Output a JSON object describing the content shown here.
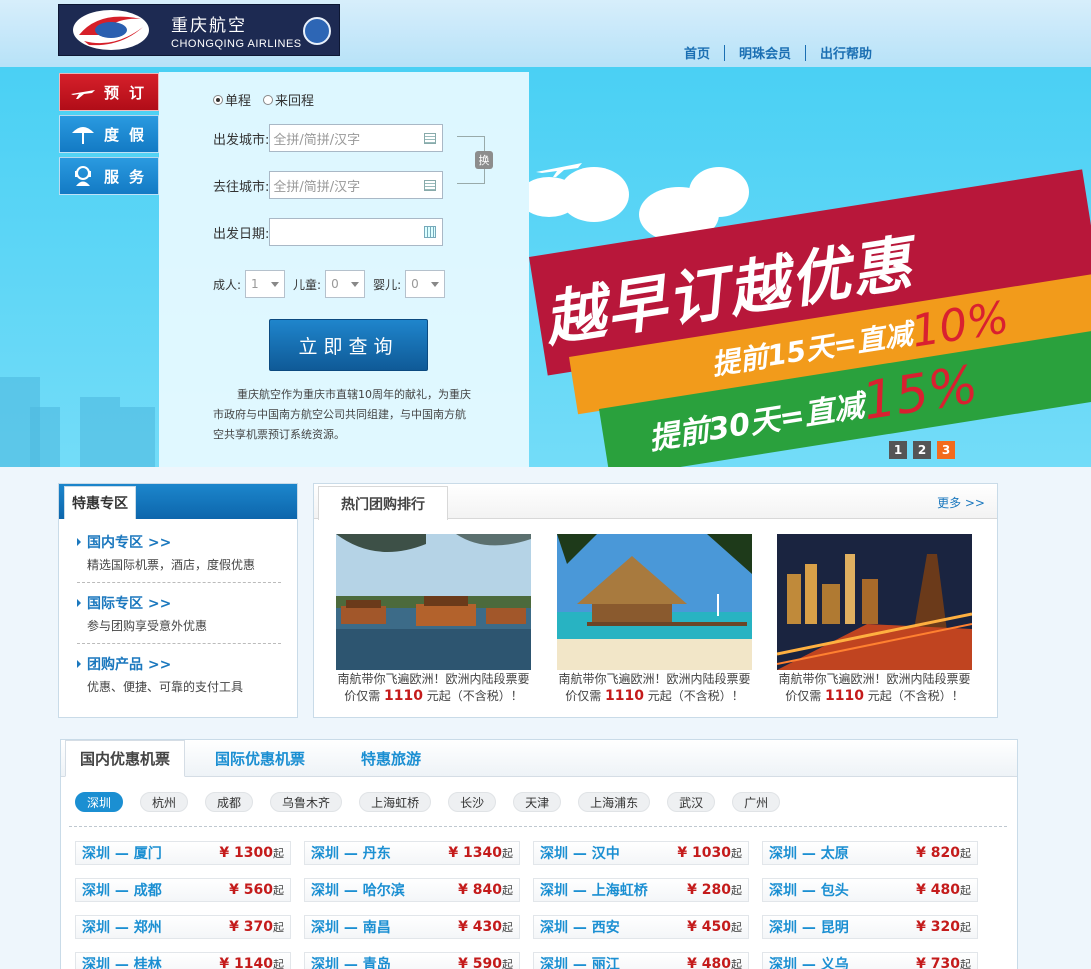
{
  "header": {
    "logo_cn": "重庆航空",
    "logo_en": "CHONGQING AIRLINES",
    "nav": [
      "首页",
      "明珠会员",
      "出行帮助"
    ]
  },
  "side_tabs": [
    {
      "label": "预订",
      "icon": "plane-icon"
    },
    {
      "label": "度假",
      "icon": "umbrella-icon"
    },
    {
      "label": "服务",
      "icon": "service-icon"
    }
  ],
  "booking": {
    "trip_types": [
      "单程",
      "来回程"
    ],
    "selected_trip": "单程",
    "depart_label": "出发城市:",
    "arrive_label": "去往城市:",
    "date_label": "出发日期:",
    "city_placeholder": "全拼/简拼/汉字",
    "swap_label": "换",
    "adult_label": "成人:",
    "child_label": "儿童:",
    "infant_label": "婴儿:",
    "adult_value": "1",
    "child_value": "0",
    "infant_value": "0",
    "search_label": "立即查询",
    "intro": "重庆航空作为重庆市直辖10周年的献礼，为重庆市政府与中国南方航空公司共同组建，与中国南方航空共享机票预订系统资源。"
  },
  "promo": {
    "headline": "越早订越优惠",
    "line1_text": "提前15天=直减",
    "line1_pct": "10%",
    "line2_text": "提前30天=直减",
    "line2_pct": "15%",
    "pages": [
      "1",
      "2",
      "3"
    ],
    "current_page": "3"
  },
  "special": {
    "title": "特惠专区",
    "items": [
      {
        "title": "国内专区 >>",
        "desc": "精选国际机票，酒店，度假优惠"
      },
      {
        "title": "国际专区 >>",
        "desc": "参与团购享受意外优惠"
      },
      {
        "title": "团购产品 >>",
        "desc": "优惠、便捷、可靠的支付工具"
      }
    ]
  },
  "hot": {
    "title": "热门团购排行",
    "more": "更多 >>",
    "cards": [
      {
        "line1": "南航带你飞遍欧洲！欧洲内陆段票要",
        "pre": "价仅需 ",
        "price": "1110",
        "post": " 元起（不含税）！"
      },
      {
        "line1": "南航带你飞遍欧洲！欧洲内陆段票要",
        "pre": "价仅需 ",
        "price": "1110",
        "post": " 元起（不含税）！"
      },
      {
        "line1": "南航带你飞遍欧洲！欧洲内陆段票要",
        "pre": "价仅需 ",
        "price": "1110",
        "post": " 元起（不含税）！"
      }
    ]
  },
  "deals": {
    "tabs": [
      "国内优惠机票",
      "国际优惠机票",
      "特惠旅游"
    ],
    "cities": [
      "深圳",
      "杭州",
      "成都",
      "乌鲁木齐",
      "上海虹桥",
      "长沙",
      "天津",
      "上海浦东",
      "武汉",
      "广州"
    ],
    "selected_city": "深圳",
    "price_suffix": "起",
    "routes": [
      {
        "route": "深圳 — 厦门",
        "price": "¥ 1300"
      },
      {
        "route": "深圳 — 丹东",
        "price": "¥ 1340"
      },
      {
        "route": "深圳 — 汉中",
        "price": "¥ 1030"
      },
      {
        "route": "深圳 — 太原",
        "price": "¥ 820"
      },
      {
        "route": "深圳 — 成都",
        "price": "¥ 560"
      },
      {
        "route": "深圳 — 哈尔滨",
        "price": "¥ 840"
      },
      {
        "route": "深圳 — 上海虹桥",
        "price": "¥ 280"
      },
      {
        "route": "深圳 — 包头",
        "price": "¥ 480"
      },
      {
        "route": "深圳 — 郑州",
        "price": "¥ 370"
      },
      {
        "route": "深圳 — 南昌",
        "price": "¥ 430"
      },
      {
        "route": "深圳 — 西安",
        "price": "¥ 450"
      },
      {
        "route": "深圳 — 昆明",
        "price": "¥ 320"
      },
      {
        "route": "深圳 — 桂林",
        "price": "¥ 1140"
      },
      {
        "route": "深圳 — 青岛",
        "price": "¥ 590"
      },
      {
        "route": "深圳 — 丽江",
        "price": "¥ 480"
      },
      {
        "route": "深圳 — 义乌",
        "price": "¥ 730"
      }
    ]
  },
  "colors": {
    "brand_blue": "#1b8fd2",
    "brand_red": "#b8173a",
    "price_red": "#c41b1b"
  }
}
